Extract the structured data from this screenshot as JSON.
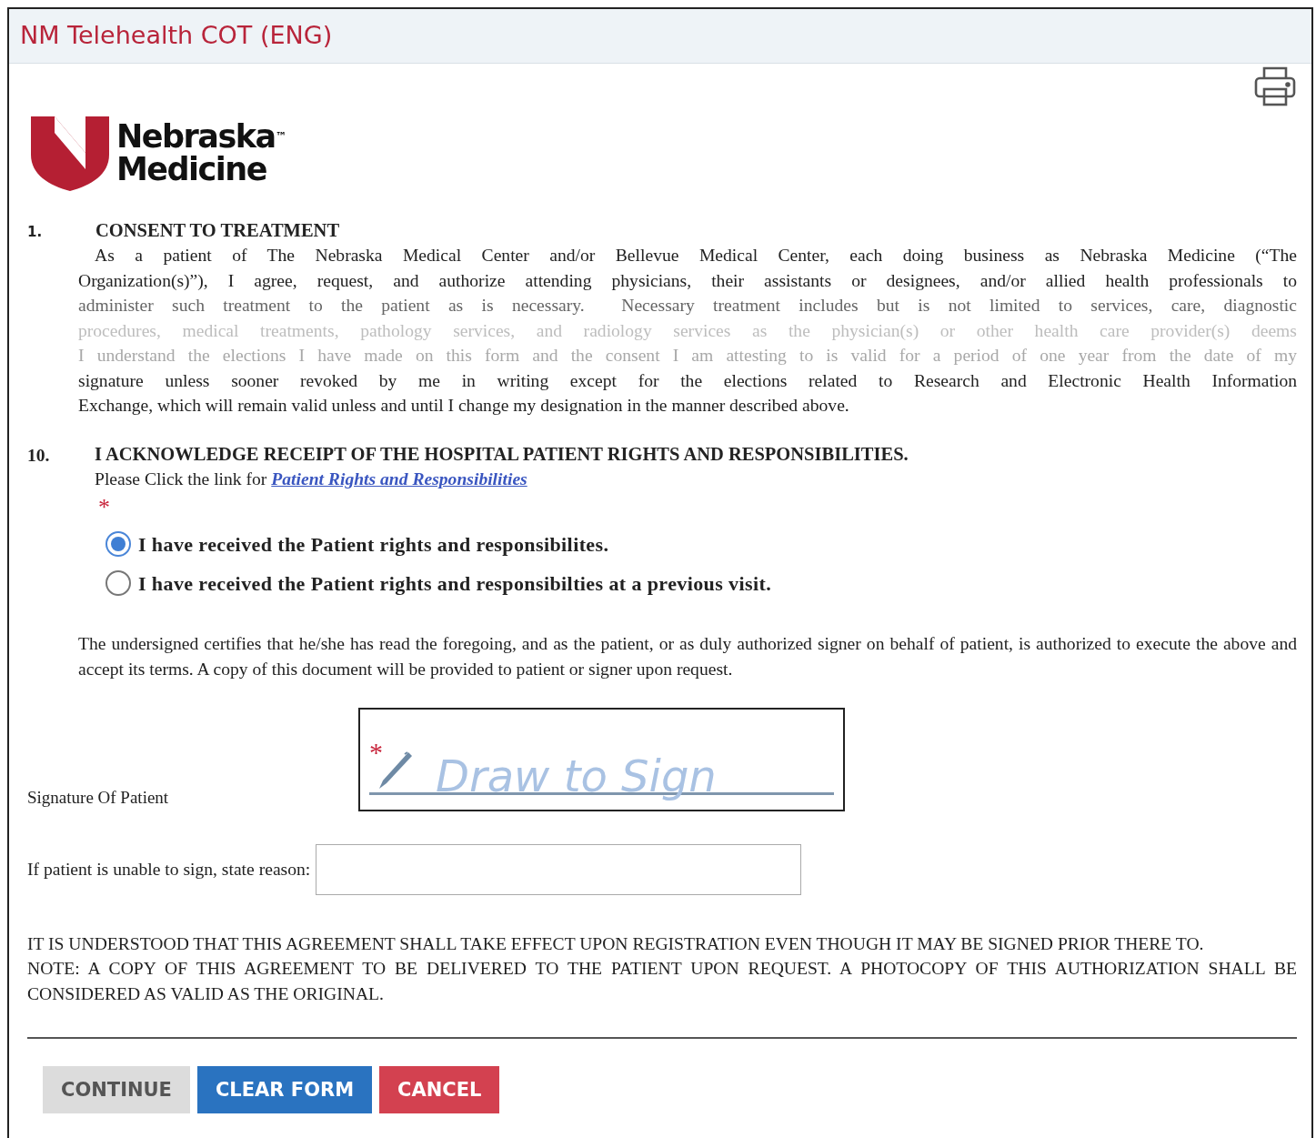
{
  "window": {
    "title": "NM Telehealth COT (ENG)"
  },
  "logo": {
    "line_1": "Nebraska",
    "line_2": "Medicine",
    "mark": "™"
  },
  "section_1": {
    "number": "1.",
    "heading": "CONSENT TO TREATMENT",
    "lines": [
      {
        "text": "As a patient of The Nebraska Medical Center and/or Bellevue Medical Center, each doing business as Nebraska Medicine (“The",
        "color": "#222222",
        "indent": true,
        "justify": true
      },
      {
        "text": "Organization(s)”), I agree, request, and authorize attending physicians, their assistants or designees, and/or allied health professionals to",
        "color": "#222222",
        "indent": false,
        "justify": true
      },
      {
        "text": "administer such treatment to the patient as is necessary.  Necessary treatment includes but is not limited to services, care, diagnostic",
        "color": "#666666",
        "indent": false,
        "justify": true
      },
      {
        "text": "procedures, medical treatments, pathology services, and radiology services as the physician(s) or other health care provider(s) deems",
        "color": "#bdbdbd",
        "indent": false,
        "justify": true
      },
      {
        "text": "I understand the elections I have made on this form and the consent I am attesting to is valid for a period of one year from the date of my",
        "color": "#a8a8a8",
        "indent": false,
        "justify": true
      },
      {
        "text": "signature unless sooner revoked by me in writing except for the elections related to Research and Electronic Health Information",
        "color": "#222222",
        "indent": false,
        "justify": true
      },
      {
        "text": "Exchange, which will remain valid unless and until I change my designation in the manner described above.",
        "color": "#222222",
        "indent": false,
        "justify": false
      }
    ]
  },
  "section_10": {
    "number": "10.",
    "heading": "I ACKNOWLEDGE RECEIPT OF THE HOSPITAL PATIENT RIGHTS AND RESPONSIBILITIES.",
    "prompt": "Please Click the link for",
    "link": "Patient Rights and Responsibilities",
    "required_mark": "*",
    "options": [
      {
        "label": "I have received the Patient rights and responsibilites.",
        "selected": true
      },
      {
        "label": "I have received the Patient rights and responsibilties at a previous visit.",
        "selected": false
      }
    ]
  },
  "certification": "The undersigned certifies that he/she has read the foregoing, and as the patient, or as duly authorized signer on behalf of patient, is authorized to execute the above and accept its terms.  A copy of this document will be provided to patient or signer upon request.",
  "signature": {
    "label": "Signature Of Patient",
    "required_mark": "*",
    "placeholder": "Draw to Sign"
  },
  "unable_reason": {
    "label": "If patient is unable to sign, state reason:"
  },
  "notes": [
    "IT IS UNDERSTOOD THAT THIS AGREEMENT SHALL TAKE EFFECT UPON REGISTRATION EVEN THOUGH IT MAY BE SIGNED PRIOR THERE TO.",
    "NOTE: A COPY OF THIS AGREEMENT TO BE DELIVERED TO THE PATIENT UPON REQUEST.  A PHOTOCOPY OF THIS AUTHORIZATION SHALL BE CONSIDERED AS VALID AS THE ORIGINAL."
  ],
  "buttons": [
    {
      "label": "CONTINUE",
      "kind": "neutral"
    },
    {
      "label": "CLEAR FORM",
      "kind": "primary"
    },
    {
      "label": "CANCEL",
      "kind": "danger"
    }
  ]
}
